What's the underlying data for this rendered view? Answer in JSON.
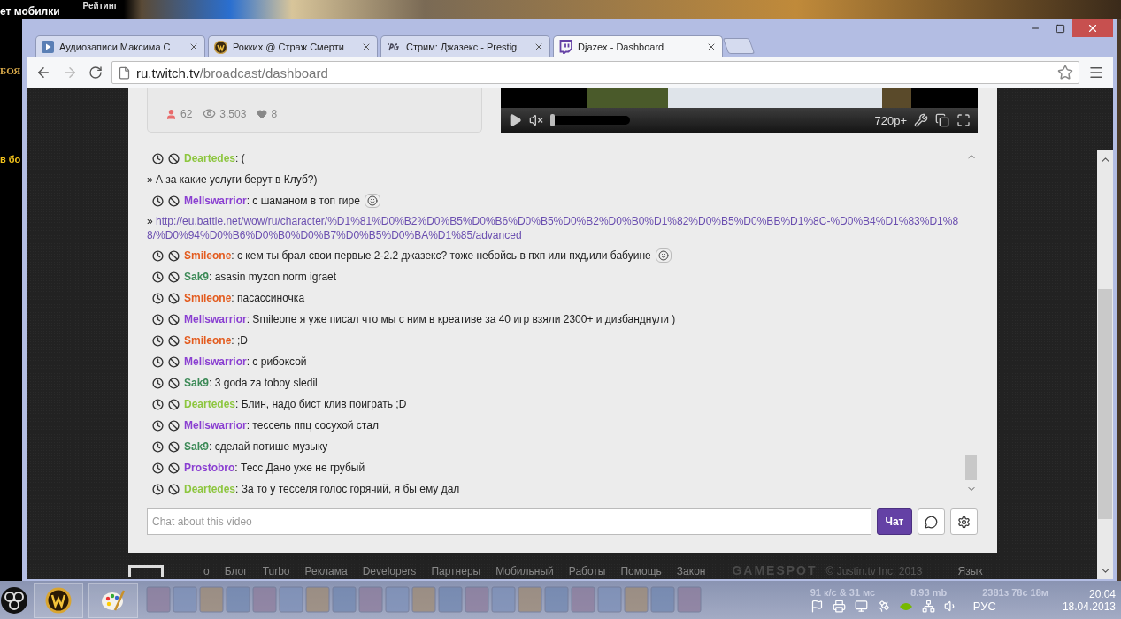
{
  "desktop": {
    "top_labels": [
      "ет мобилки",
      "Рейтинг"
    ],
    "side_labels": [
      "БОЯ",
      "в бо"
    ]
  },
  "browser": {
    "tabs": [
      {
        "title": "Аудиозаписи Максима С",
        "selected": false
      },
      {
        "title": "Рокких @ Страж Смерти",
        "selected": false
      },
      {
        "title": "Стрим: Джазекс - Prestig",
        "selected": false
      },
      {
        "title": "Djazex - Dashboard",
        "selected": true
      }
    ],
    "address": {
      "host": "ru.twitch.tv",
      "path": "/broadcast/dashboard"
    }
  },
  "stats": [
    {
      "kind": "viewers",
      "value": "62"
    },
    {
      "kind": "views",
      "value": "3,503"
    },
    {
      "kind": "followers",
      "value": "8"
    }
  ],
  "player": {
    "muted": true,
    "quality": "720p+"
  },
  "chat": {
    "messages": [
      {
        "kind": "message",
        "user": "Deartedes",
        "color": "#8dc63f",
        "text": ": (",
        "emote": false
      },
      {
        "kind": "continuation",
        "text": "» А за какие услуги берут в Клуб?)"
      },
      {
        "kind": "message",
        "user": "Mellswarrior",
        "color": "#8a3fd1",
        "text": ": с шаманом в топ гире",
        "emote": true
      },
      {
        "kind": "link",
        "prefix": "»",
        "text": "http://eu.battle.net/wow/ru/character/%D1%81%D0%B2%D0%B5%D0%B6%D0%B5%D0%B2%D0%B0%D1%82%D0%B5%D0%BB%D1%8C-%D0%B4%D1%83%D1%88/%D0%94%D0%B6%D0%B0%D0%B7%D0%B5%D0%BA%D1%85/advanced"
      },
      {
        "kind": "message",
        "user": "Smileone",
        "color": "#e35b1e",
        "text": ": с кем ты брал свои первые 2-2.2 джазекс? тоже небойсь в пхп или пхд,или бабуине",
        "emote": true
      },
      {
        "kind": "message",
        "user": "Sak9",
        "color": "#3c8a57",
        "text": ": asasin myzon norm igraet",
        "emote": false
      },
      {
        "kind": "message",
        "user": "Smileone",
        "color": "#e35b1e",
        "text": ": пасассиночка",
        "emote": false
      },
      {
        "kind": "message",
        "user": "Mellswarrior",
        "color": "#8a3fd1",
        "text": ": Smileone я уже писал что мы с ним в креативе за 40 игр взяли 2300+ и дизбанднули )",
        "emote": false
      },
      {
        "kind": "message",
        "user": "Smileone",
        "color": "#e35b1e",
        "text": ": ;D",
        "emote": false
      },
      {
        "kind": "message",
        "user": "Mellswarrior",
        "color": "#8a3fd1",
        "text": ": с рибоксой",
        "emote": false
      },
      {
        "kind": "message",
        "user": "Sak9",
        "color": "#3c8a57",
        "text": ": 3 goda za toboy sledil",
        "emote": false
      },
      {
        "kind": "message",
        "user": "Deartedes",
        "color": "#8dc63f",
        "text": ": Блин, надо бист клив поиграть ;D",
        "emote": false
      },
      {
        "kind": "message",
        "user": "Mellswarrior",
        "color": "#8a3fd1",
        "text": ": тессель ппц сосухой стал",
        "emote": false
      },
      {
        "kind": "message",
        "user": "Sak9",
        "color": "#3c8a57",
        "text": ": сделай потише музыку",
        "emote": false
      },
      {
        "kind": "message",
        "user": "Prostobro",
        "color": "#8a3fd1",
        "text": ": Тесс Дано уже не грубый",
        "emote": false
      },
      {
        "kind": "message",
        "user": "Deartedes",
        "color": "#8dc63f",
        "text": ": За то у тесселя голос горячий, я бы ему дал",
        "emote": false
      }
    ],
    "input": {
      "placeholder": "Chat about this video"
    },
    "send_label": "Чат"
  },
  "footer": {
    "links": [
      "о",
      "Блог",
      "Turbo",
      "Реклама",
      "Developers",
      "Партнеры",
      "Мобильный",
      "Работы",
      "Помощь",
      "Закон"
    ],
    "sponsor": "GAMESPOT",
    "copyright": "© Justin.tv Inc. 2013",
    "language": "Язык"
  },
  "taskbar": {
    "overlay": [
      "91 к/с & 31 мс",
      "8.93 mb",
      "2381з 78с 18м"
    ],
    "language": "РУС",
    "time": "20:04",
    "date": "18.04.2013"
  }
}
